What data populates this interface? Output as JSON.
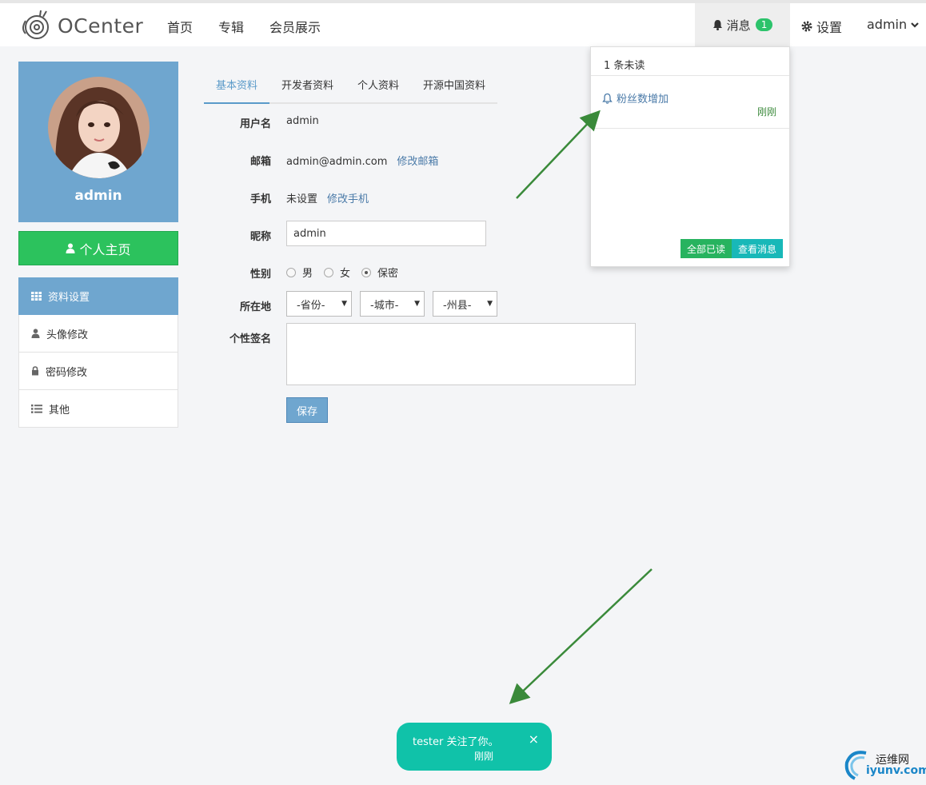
{
  "header": {
    "brand": "OCenter",
    "nav": [
      "首页",
      "专辑",
      "会员展示"
    ],
    "messages_label": "消息",
    "messages_count": "1",
    "settings_label": "设置",
    "user_label": "admin"
  },
  "notifications": {
    "unread_text": "1 条未读",
    "items": [
      {
        "title": "粉丝数增加",
        "time": "刚刚"
      }
    ],
    "mark_all_read": "全部已读",
    "view_messages": "查看消息"
  },
  "profile": {
    "name": "admin",
    "home_button": "个人主页",
    "menu": [
      {
        "label": "资料设置",
        "icon": "grid-icon",
        "active": true
      },
      {
        "label": "头像修改",
        "icon": "user-icon"
      },
      {
        "label": "密码修改",
        "icon": "lock-icon"
      },
      {
        "label": "其他",
        "icon": "list-icon"
      }
    ]
  },
  "tabs": [
    "基本资料",
    "开发者资料",
    "个人资料",
    "开源中国资料"
  ],
  "form": {
    "username_label": "用户名",
    "username_value": "admin",
    "email_label": "邮箱",
    "email_value": "admin@admin.com",
    "email_link": "修改邮箱",
    "phone_label": "手机",
    "phone_value": "未设置",
    "phone_link": "修改手机",
    "nickname_label": "昵称",
    "nickname_value": "admin",
    "gender_label": "性别",
    "gender_options": [
      "男",
      "女",
      "保密"
    ],
    "gender_selected": "保密",
    "location_label": "所在地",
    "province": "-省份-",
    "city": "-城市-",
    "county": "-州县-",
    "signature_label": "个性签名",
    "save_label": "保存"
  },
  "toast": {
    "text": "tester 关注了你。",
    "time": "刚刚",
    "close": "×"
  },
  "watermark": {
    "line1": "运维网",
    "line2": "iyunv.com"
  },
  "colors": {
    "accent_blue": "#6fa6cf",
    "green": "#2cc25d",
    "toast_teal": "#10c2a9"
  }
}
